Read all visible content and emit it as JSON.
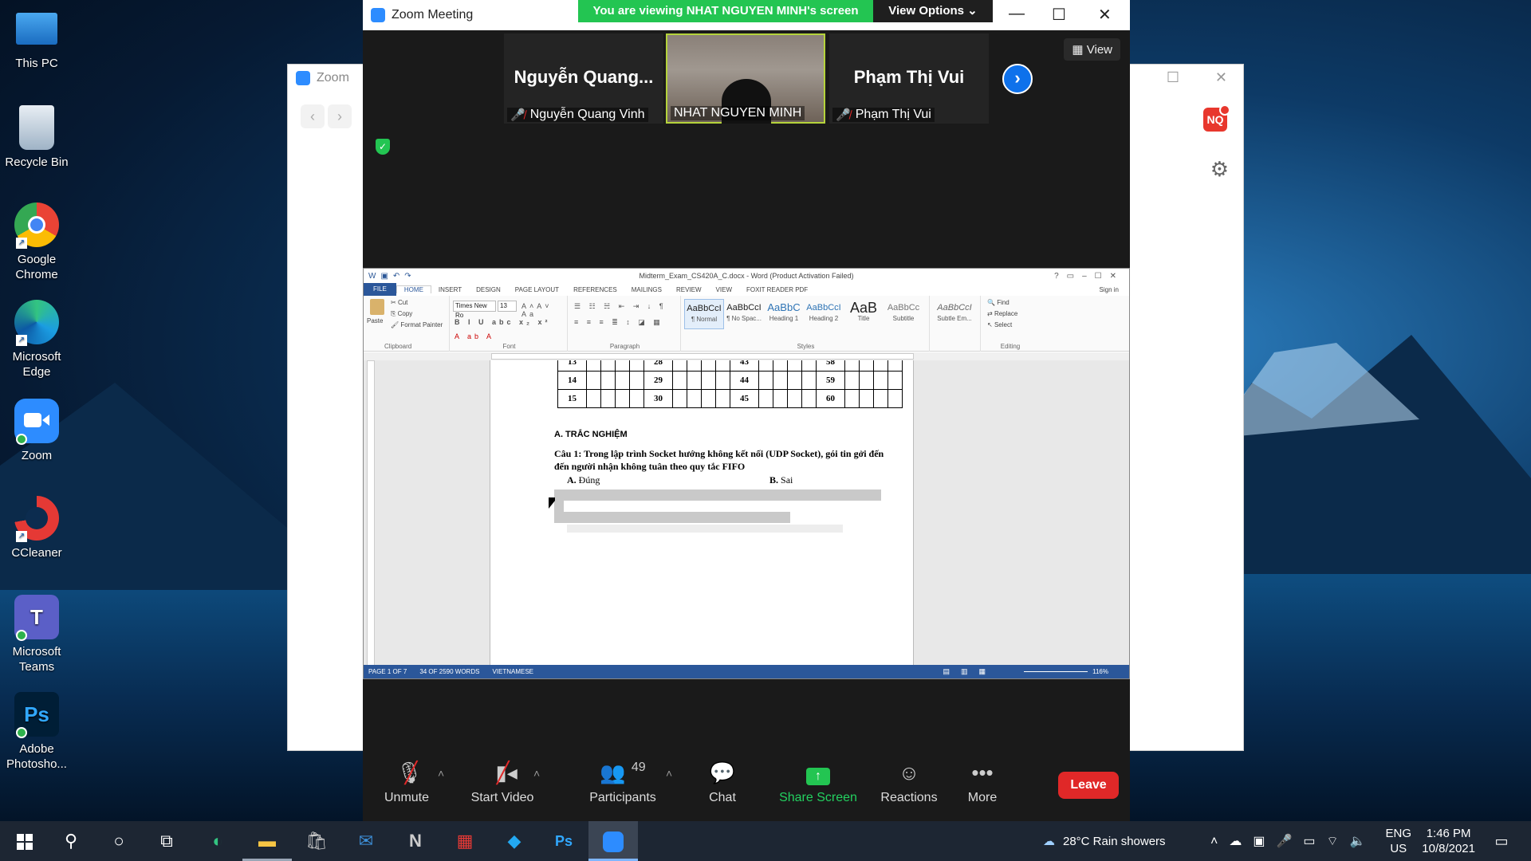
{
  "desktop": {
    "icons": [
      {
        "label": "This PC",
        "icon": "computer-icon"
      },
      {
        "label": "Recycle Bin",
        "icon": "recycle-bin-icon"
      },
      {
        "label": "Google Chrome",
        "icon": "chrome-icon"
      },
      {
        "label": "Microsoft Edge",
        "icon": "edge-icon"
      },
      {
        "label": "Zoom",
        "icon": "zoom-icon"
      },
      {
        "label": "CCleaner",
        "icon": "ccleaner-icon"
      },
      {
        "label": "Microsoft Teams",
        "icon": "teams-icon"
      },
      {
        "label": "Adobe Photosho...",
        "icon": "photoshop-icon"
      }
    ]
  },
  "zoom_home": {
    "title": "Zoom",
    "avatar_initials": "NQ"
  },
  "meeting": {
    "title": "Zoom Meeting",
    "viewing_banner": "You are viewing NHAT NGUYEN MINH's screen",
    "view_options": "View Options",
    "view_button": "View",
    "participants": [
      {
        "big_name": "Nguyễn  Quang...",
        "name": "Nguyễn Quang Vinh",
        "muted": true
      },
      {
        "big_name": "",
        "name": "NHAT NGUYEN MINH",
        "muted": false
      },
      {
        "big_name": "Phạm Thị Vui",
        "name": "Phạm Thị Vui",
        "muted": true
      }
    ],
    "toolbar": {
      "unmute": "Unmute",
      "start_video": "Start Video",
      "participants": "Participants",
      "participants_count": "49",
      "chat": "Chat",
      "share_screen": "Share Screen",
      "reactions": "Reactions",
      "more": "More",
      "leave": "Leave"
    }
  },
  "word": {
    "title": "Midterm_Exam_CS420A_C.docx - Word (Product Activation Failed)",
    "tabs": [
      "FILE",
      "HOME",
      "INSERT",
      "DESIGN",
      "PAGE LAYOUT",
      "REFERENCES",
      "MAILINGS",
      "REVIEW",
      "VIEW",
      "FOXIT READER PDF"
    ],
    "sign_in": "Sign in",
    "clipboard": {
      "paste": "Paste",
      "cut": "Cut",
      "copy": "Copy",
      "format_painter": "Format Painter",
      "group": "Clipboard"
    },
    "font": {
      "name": "Times New Ro",
      "size": "13",
      "group": "Font"
    },
    "paragraph_group": "Paragraph",
    "styles": [
      {
        "sample": "AaBbCcI",
        "name": "¶ Normal"
      },
      {
        "sample": "AaBbCcI",
        "name": "¶ No Spac..."
      },
      {
        "sample": "AaBbC",
        "name": "Heading 1"
      },
      {
        "sample": "AaBbCcI",
        "name": "Heading 2"
      },
      {
        "sample": "AaB",
        "name": "Title"
      },
      {
        "sample": "AaBbCc",
        "name": "Subtitle"
      },
      {
        "sample": "AaBbCcI",
        "name": "Subtle Em..."
      }
    ],
    "styles_group": "Styles",
    "editing": {
      "find": "Find",
      "replace": "Replace",
      "select": "Select",
      "group": "Editing"
    },
    "table_rows": [
      {
        "c1": "13",
        "c2": "28",
        "c3": "43",
        "c4": "58"
      },
      {
        "c1": "14",
        "c2": "29",
        "c3": "44",
        "c4": "59"
      },
      {
        "c1": "15",
        "c2": "30",
        "c3": "45",
        "c4": "60"
      }
    ],
    "section_title": "A.   TRẮC NGHIỆM",
    "question1": "Câu 1: Trong lập trình Socket hướng không kết nối (UDP Socket),  gói tin gởi đến đến người nhận không tuân theo quy tắc FIFO",
    "option_a_label": "A.",
    "option_a": "Đúng",
    "option_b_label": "B.",
    "option_b": "Sai",
    "status": {
      "page": "PAGE 1 OF 7",
      "words": "34 OF 2590 WORDS",
      "language": "VIETNAMESE",
      "zoom": "116%"
    }
  },
  "taskbar": {
    "weather": "28°C  Rain showers",
    "lang_top": "ENG",
    "lang_bottom": "US",
    "time": "1:46 PM",
    "date": "10/8/2021"
  }
}
